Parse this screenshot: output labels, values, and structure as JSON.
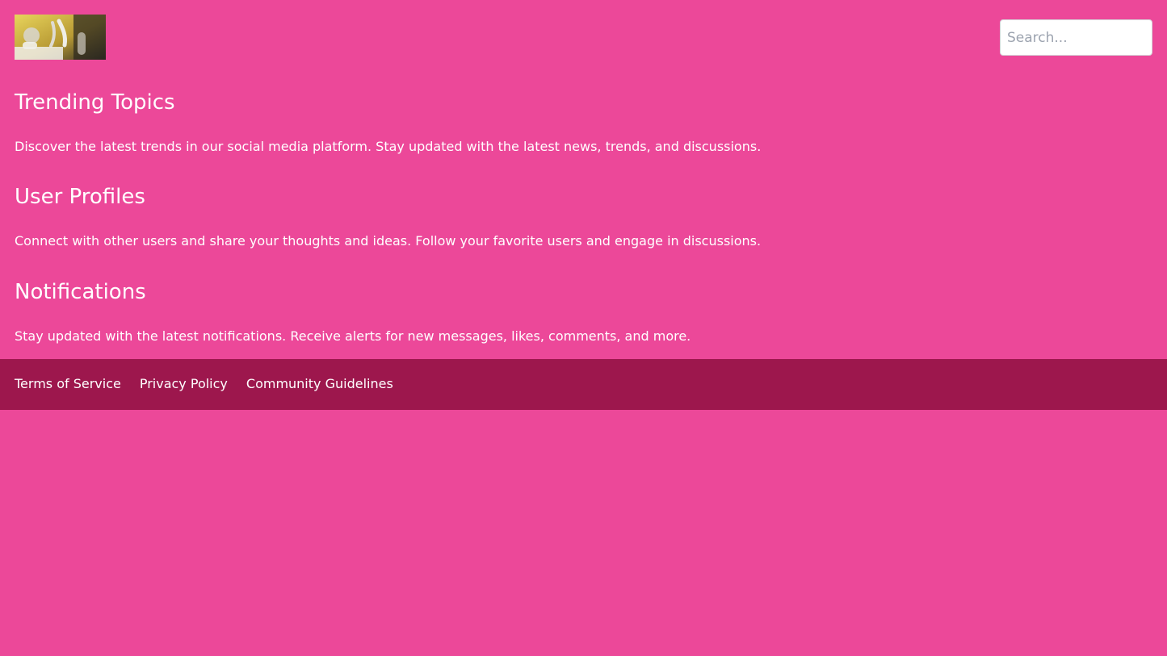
{
  "header": {
    "logo_alt": "Logo",
    "search": {
      "placeholder": "Search...",
      "value": ""
    }
  },
  "sections": [
    {
      "title": "Trending Topics",
      "text": "Discover the latest trends in our social media platform. Stay updated with the latest news, trends, and discussions."
    },
    {
      "title": "User Profiles",
      "text": "Connect with other users and share your thoughts and ideas. Follow your favorite users and engage in discussions."
    },
    {
      "title": "Notifications",
      "text": "Stay updated with the latest notifications. Receive alerts for new messages, likes, comments, and more."
    }
  ],
  "footer": {
    "links": [
      "Terms of Service",
      "Privacy Policy",
      "Community Guidelines"
    ]
  },
  "colors": {
    "background": "#ec4899",
    "footer": "#9d174d",
    "text": "#ffffff",
    "search_background": "#ffffff"
  },
  "icons": {
    "logo": "logo-image"
  }
}
